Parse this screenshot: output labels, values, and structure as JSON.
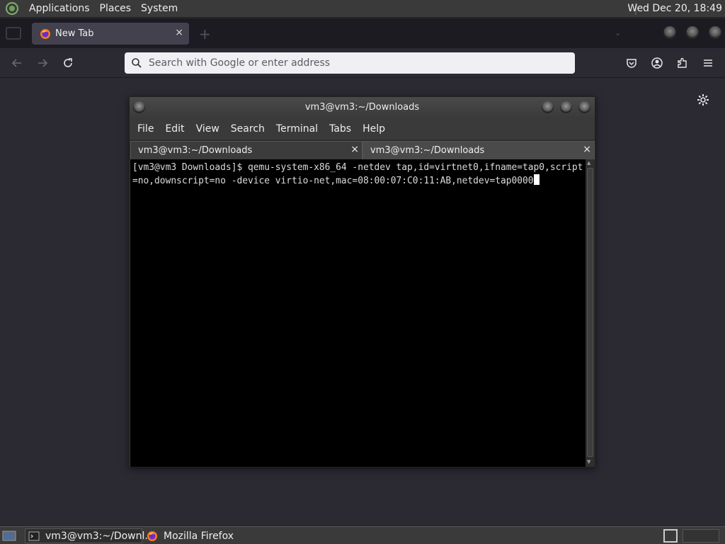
{
  "top_panel": {
    "menus": [
      "Applications",
      "Places",
      "System"
    ],
    "clock": "Wed Dec 20, 18:49"
  },
  "firefox": {
    "tab_title": "New Tab",
    "tab_close": "×",
    "new_tab": "+",
    "list_all": "⌄",
    "search_placeholder": "Search with Google or enter address"
  },
  "terminal": {
    "window_title": "vm3@vm3:~/Downloads",
    "menu": [
      "File",
      "Edit",
      "View",
      "Search",
      "Terminal",
      "Tabs",
      "Help"
    ],
    "tabs": [
      {
        "label": "vm3@vm3:~/Downloads",
        "close": "×"
      },
      {
        "label": "vm3@vm3:~/Downloads",
        "close": "×"
      }
    ],
    "content": "[vm3@vm3 Downloads]$ qemu-system-x86_64 -netdev tap,id=virtnet0,ifname=tap0,script=no,downscript=no -device virtio-net,mac=08:00:07:C0:11:AB,netdev=tap0000"
  },
  "bottom_panel": {
    "tasks": [
      {
        "label": "vm3@vm3:~/Downl..."
      },
      {
        "label": "Mozilla Firefox"
      }
    ]
  },
  "colors": {
    "panel": "#3a3a3a",
    "firefox_bg": "#2b2a33",
    "terminal_bg": "#000000"
  }
}
